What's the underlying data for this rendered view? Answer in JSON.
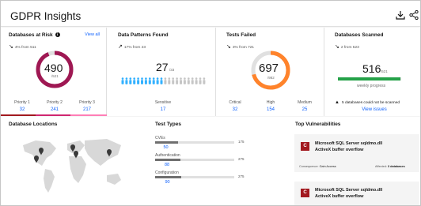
{
  "header": {
    "title": "GDPR Insights"
  },
  "risk": {
    "title": "Databases at Risk",
    "view_all": "View all",
    "trend": "4% from 511",
    "value": "490",
    "denom": "/521",
    "fraction": 0.94,
    "priorities": [
      {
        "label": "Priority 1",
        "value": "32",
        "color": "#a2191f"
      },
      {
        "label": "Priority 2",
        "value": "241",
        "color": "#d02670"
      },
      {
        "label": "Priority 3",
        "value": "217",
        "color": "#ff7eb6"
      }
    ]
  },
  "patterns": {
    "title": "Data Patterns Found",
    "trend": "17% from 23",
    "value": "27",
    "denom": "/33",
    "sensitive_label": "Sensitive",
    "sensitive_value": "17",
    "highlighted": 17,
    "total": 33
  },
  "tests": {
    "title": "Tests Failed",
    "trend": "3% from 721",
    "value": "697",
    "denom": "/982",
    "fraction": 0.71,
    "stats": [
      {
        "label": "Critical",
        "value": "32"
      },
      {
        "label": "High",
        "value": "154"
      },
      {
        "label": "Medium",
        "value": "25"
      }
    ]
  },
  "scanned": {
    "title": "Databases Scanned",
    "trend": "2 from 523",
    "value": "516",
    "denom": "/521",
    "progress_label": "weekly progress",
    "progress": 0.99,
    "warning": "5 databases could not be scanned",
    "view_issues": "View issues"
  },
  "locations": {
    "title": "Database Locations"
  },
  "test_types": {
    "title": "Test Types",
    "items": [
      {
        "label": "CVEs",
        "max": "175",
        "value": "50",
        "fraction": 0.29
      },
      {
        "label": "Authentication",
        "max": "275",
        "value": "88",
        "fraction": 0.32
      },
      {
        "label": "Configuration",
        "max": "275",
        "value": "90",
        "fraction": 0.33
      }
    ]
  },
  "vulns": {
    "title": "Top Vulnerabilities",
    "items": [
      {
        "icon": "C",
        "name": "Microsoft SQL Server sqldmo.dll ActiveX buffer overflow",
        "consequence_label": "Consequence:",
        "consequence": "Gain Access",
        "affected_label": "Affected:",
        "affected": "3 databases"
      },
      {
        "icon": "C",
        "name": "Microsoft SQL Server sqldmo.dll ActiveX buffer overflow"
      }
    ]
  },
  "colors": {
    "accent": "#0f62fe",
    "risk_ring": "#9f1853",
    "risk_ring_light": "#d02670",
    "tests_ring": "#ff832b",
    "patterns_people": "#33b1ff",
    "progress": "#24a148"
  }
}
